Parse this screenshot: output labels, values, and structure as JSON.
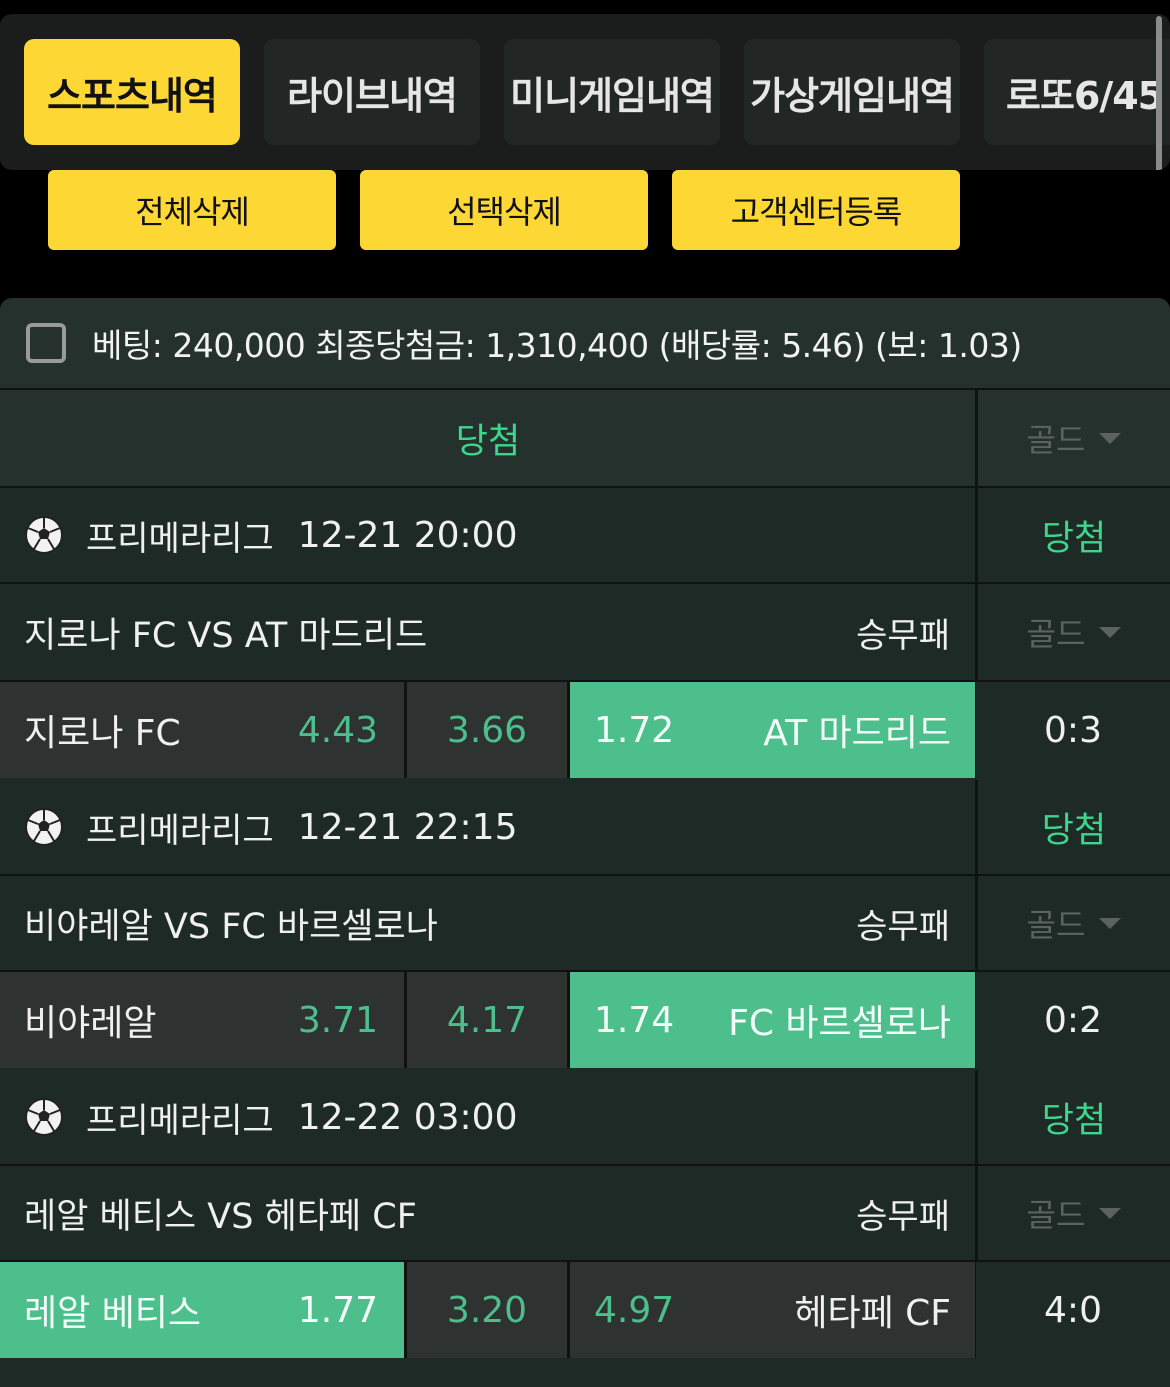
{
  "tabs": [
    {
      "label": "스포츠내역",
      "active": true
    },
    {
      "label": "라이브내역",
      "active": false
    },
    {
      "label": "미니게임내역",
      "active": false
    },
    {
      "label": "가상게임내역",
      "active": false
    },
    {
      "label": "로또6/45",
      "active": false
    }
  ],
  "actions": {
    "delete_all": "전체삭제",
    "delete_selected": "선택삭제",
    "register_support": "고객센터등록"
  },
  "summary": {
    "text": "베팅: 240,000 최종당첨금: 1,310,400 (배당률: 5.46) (보: 1.03)"
  },
  "status_header": {
    "result": "당첨",
    "grade": "골드"
  },
  "matches": [
    {
      "league": "프리메라리그",
      "datetime": "12-21 20:00",
      "result": "당첨",
      "title": "지로나 FC VS AT 마드리드",
      "market": "승무패",
      "grade": "골드",
      "home": "지로나 FC",
      "home_odds": "4.43",
      "draw_odds": "3.66",
      "away_odds": "1.72",
      "away": "AT 마드리드",
      "score": "0:3"
    },
    {
      "league": "프리메라리그",
      "datetime": "12-21 22:15",
      "result": "당첨",
      "title": "비야레알 VS FC 바르셀로나",
      "market": "승무패",
      "grade": "골드",
      "home": "비야레알",
      "home_odds": "3.71",
      "draw_odds": "4.17",
      "away_odds": "1.74",
      "away": "FC 바르셀로나",
      "score": "0:2"
    },
    {
      "league": "프리메라리그",
      "datetime": "12-22 03:00",
      "result": "당첨",
      "title": "레알 베티스 VS 헤타페 CF",
      "market": "승무패",
      "grade": "골드",
      "home": "레알 베티스",
      "home_odds": "1.77",
      "draw_odds": "3.20",
      "away_odds": "4.97",
      "away": "헤타페 CF",
      "score": "4:0"
    }
  ],
  "colors": {
    "accent": "#fdd835",
    "win": "#4dbf8d",
    "win_text": "#3dd68c"
  }
}
